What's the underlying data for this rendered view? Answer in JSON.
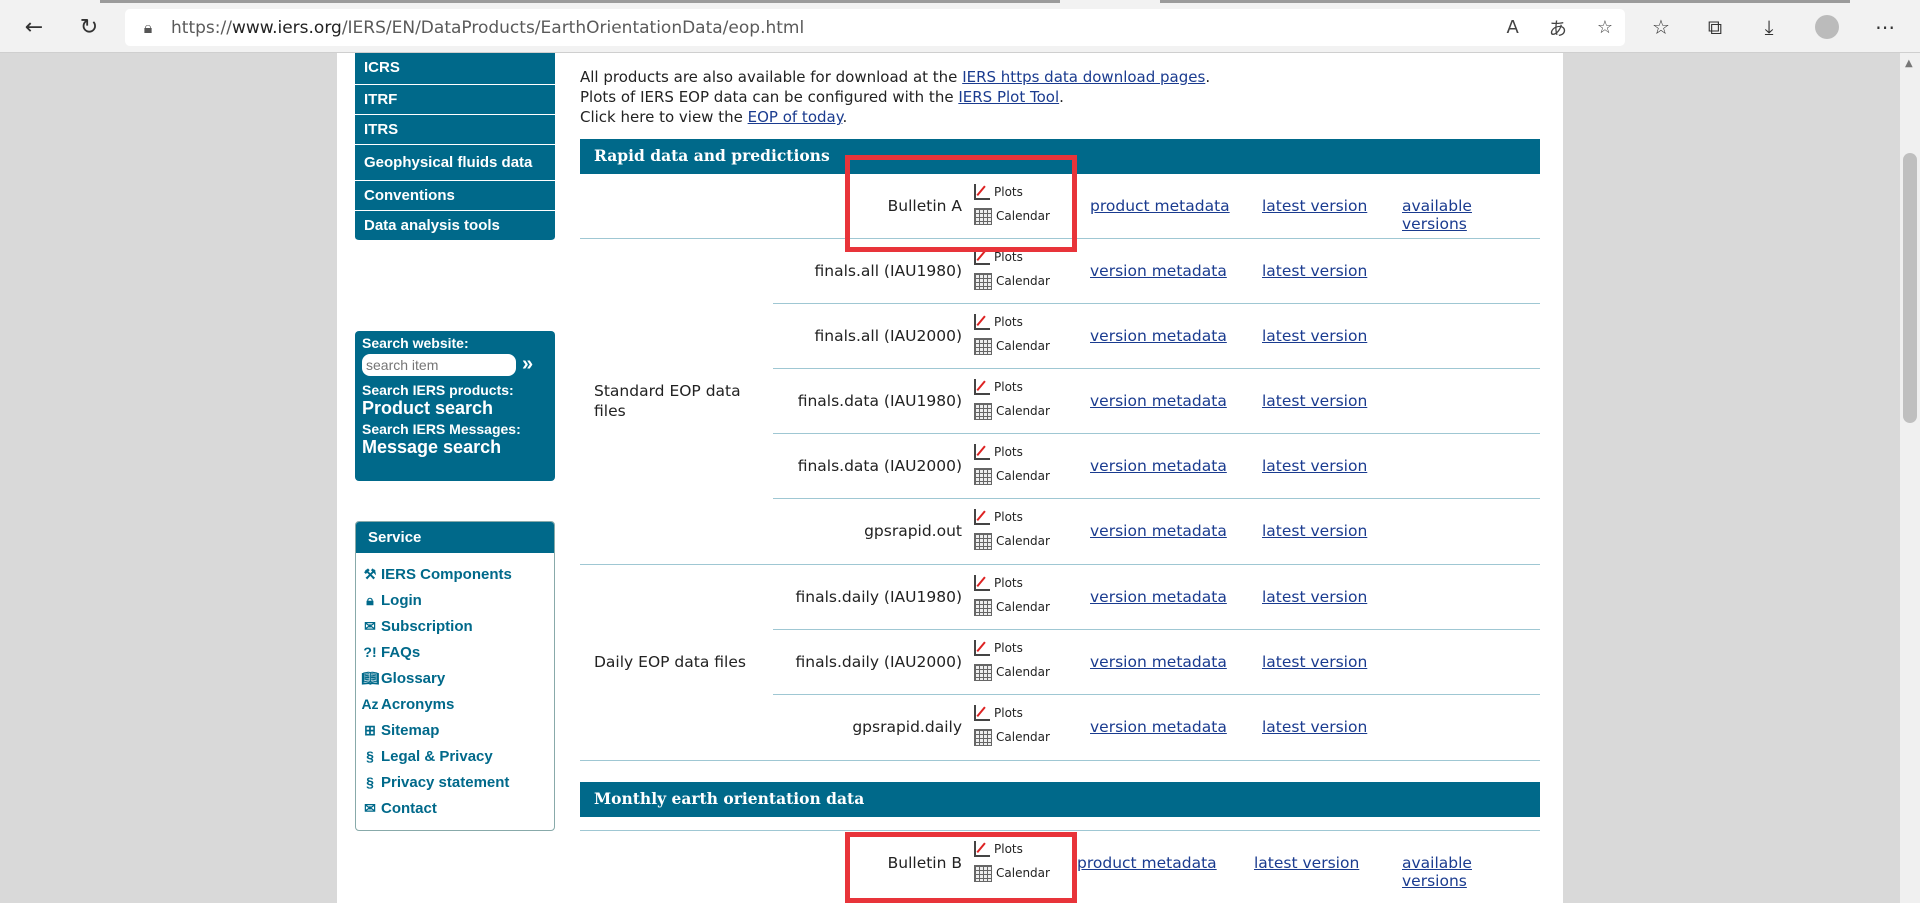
{
  "browser": {
    "url_prefix": "https://",
    "url_host": "www.iers.org",
    "url_path": "/IERS/EN/DataProducts/EarthOrientationData/eop.html"
  },
  "sidenav": {
    "items": [
      "ICRS",
      "ITRF",
      "ITRS",
      "Geophysical fluids data",
      "Conventions",
      "Data analysis tools"
    ]
  },
  "search": {
    "website_label": "Search website:",
    "placeholder": "search item",
    "products_label": "Search IERS products:",
    "products_link": "Product search",
    "messages_label": "Search IERS Messages:",
    "messages_link": "Message search"
  },
  "service": {
    "title": "Service",
    "items": [
      "IERS Components",
      "Login",
      "Subscription",
      "FAQs",
      "Glossary",
      "Acronyms",
      "Sitemap",
      "Legal & Privacy",
      "Privacy statement",
      "Contact"
    ]
  },
  "intro": {
    "line1_pre": "All products are also available for download at the ",
    "line1_link": "IERS https data download pages",
    "line1_post": ".",
    "line2_pre": "Plots of IERS EOP data can be configured with the ",
    "line2_link": "IERS Plot Tool",
    "line2_post": ".",
    "line3_pre": "Click here to view the ",
    "line3_link": "EOP of today",
    "line3_post": "."
  },
  "labels": {
    "plots": "Plots",
    "calendar": "Calendar",
    "product_metadata": "product metadata",
    "version_metadata": "version metadata",
    "latest_version": "latest version",
    "available_versions": "available versions"
  },
  "section_rapid": {
    "title": "Rapid data and predictions",
    "bulletin_a": "Bulletin A",
    "standard_group": "Standard EOP data files",
    "standard_rows": [
      "finals.all (IAU1980)",
      "finals.all (IAU2000)",
      "finals.data (IAU1980)",
      "finals.data (IAU2000)",
      "gpsrapid.out"
    ],
    "daily_group": "Daily EOP data files",
    "daily_rows": [
      "finals.daily (IAU1980)",
      "finals.daily (IAU2000)",
      "gpsrapid.daily"
    ]
  },
  "section_monthly": {
    "title": "Monthly earth orientation data",
    "bulletin_b": "Bulletin B"
  }
}
